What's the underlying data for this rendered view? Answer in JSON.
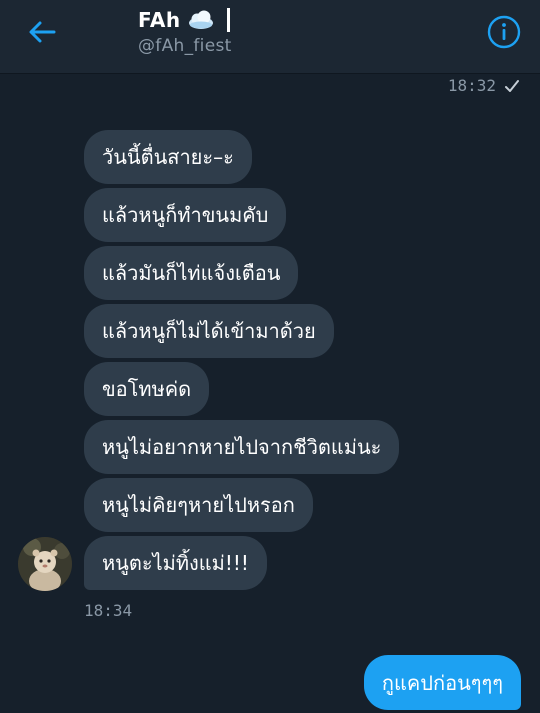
{
  "header": {
    "title": "FAh",
    "handle": "@fAh_fiest",
    "icons": [
      "back-arrow-icon",
      "cloud-icon",
      "info-icon"
    ]
  },
  "top_message": {
    "time": "18:32",
    "status_icon": "checkmark-icon"
  },
  "received": {
    "messages": [
      "วันนี้ตื่นสายะ–ะ",
      "แล้วหนูก็ทำขนมคับ",
      "แล้วมันก็ไท่แจ้งเตือน",
      "แล้วหนูก็ไม่ได้เข้ามาด้วย",
      "ขอโทษค่ด",
      "หนูไม่อยากหายไปจากชีวิตแม่นะ",
      "หนูไม่คิยๆหายไปหรอก",
      "หนูตะไม่ทิ้งแม่!!!"
    ],
    "time": "18:34"
  },
  "sent": {
    "messages": [
      "กูแคปก่อนๆๆๆ"
    ]
  },
  "colors": {
    "background": "#16202b",
    "header": "#1c2733",
    "received_bubble": "#2f3d4b",
    "sent_bubble": "#1da1f2",
    "accent": "#1da1f2",
    "muted_text": "#8a98a6"
  }
}
